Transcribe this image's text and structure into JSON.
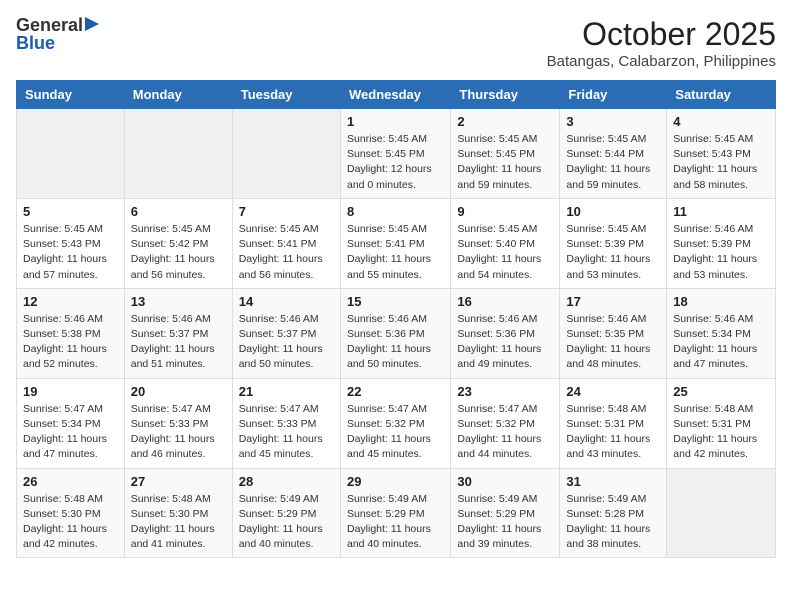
{
  "logo": {
    "general": "General",
    "blue": "Blue"
  },
  "title": "October 2025",
  "location": "Batangas, Calabarzon, Philippines",
  "headers": [
    "Sunday",
    "Monday",
    "Tuesday",
    "Wednesday",
    "Thursday",
    "Friday",
    "Saturday"
  ],
  "weeks": [
    [
      {
        "day": "",
        "info": ""
      },
      {
        "day": "",
        "info": ""
      },
      {
        "day": "",
        "info": ""
      },
      {
        "day": "1",
        "info": "Sunrise: 5:45 AM\nSunset: 5:45 PM\nDaylight: 12 hours\nand 0 minutes."
      },
      {
        "day": "2",
        "info": "Sunrise: 5:45 AM\nSunset: 5:45 PM\nDaylight: 11 hours\nand 59 minutes."
      },
      {
        "day": "3",
        "info": "Sunrise: 5:45 AM\nSunset: 5:44 PM\nDaylight: 11 hours\nand 59 minutes."
      },
      {
        "day": "4",
        "info": "Sunrise: 5:45 AM\nSunset: 5:43 PM\nDaylight: 11 hours\nand 58 minutes."
      }
    ],
    [
      {
        "day": "5",
        "info": "Sunrise: 5:45 AM\nSunset: 5:43 PM\nDaylight: 11 hours\nand 57 minutes."
      },
      {
        "day": "6",
        "info": "Sunrise: 5:45 AM\nSunset: 5:42 PM\nDaylight: 11 hours\nand 56 minutes."
      },
      {
        "day": "7",
        "info": "Sunrise: 5:45 AM\nSunset: 5:41 PM\nDaylight: 11 hours\nand 56 minutes."
      },
      {
        "day": "8",
        "info": "Sunrise: 5:45 AM\nSunset: 5:41 PM\nDaylight: 11 hours\nand 55 minutes."
      },
      {
        "day": "9",
        "info": "Sunrise: 5:45 AM\nSunset: 5:40 PM\nDaylight: 11 hours\nand 54 minutes."
      },
      {
        "day": "10",
        "info": "Sunrise: 5:45 AM\nSunset: 5:39 PM\nDaylight: 11 hours\nand 53 minutes."
      },
      {
        "day": "11",
        "info": "Sunrise: 5:46 AM\nSunset: 5:39 PM\nDaylight: 11 hours\nand 53 minutes."
      }
    ],
    [
      {
        "day": "12",
        "info": "Sunrise: 5:46 AM\nSunset: 5:38 PM\nDaylight: 11 hours\nand 52 minutes."
      },
      {
        "day": "13",
        "info": "Sunrise: 5:46 AM\nSunset: 5:37 PM\nDaylight: 11 hours\nand 51 minutes."
      },
      {
        "day": "14",
        "info": "Sunrise: 5:46 AM\nSunset: 5:37 PM\nDaylight: 11 hours\nand 50 minutes."
      },
      {
        "day": "15",
        "info": "Sunrise: 5:46 AM\nSunset: 5:36 PM\nDaylight: 11 hours\nand 50 minutes."
      },
      {
        "day": "16",
        "info": "Sunrise: 5:46 AM\nSunset: 5:36 PM\nDaylight: 11 hours\nand 49 minutes."
      },
      {
        "day": "17",
        "info": "Sunrise: 5:46 AM\nSunset: 5:35 PM\nDaylight: 11 hours\nand 48 minutes."
      },
      {
        "day": "18",
        "info": "Sunrise: 5:46 AM\nSunset: 5:34 PM\nDaylight: 11 hours\nand 47 minutes."
      }
    ],
    [
      {
        "day": "19",
        "info": "Sunrise: 5:47 AM\nSunset: 5:34 PM\nDaylight: 11 hours\nand 47 minutes."
      },
      {
        "day": "20",
        "info": "Sunrise: 5:47 AM\nSunset: 5:33 PM\nDaylight: 11 hours\nand 46 minutes."
      },
      {
        "day": "21",
        "info": "Sunrise: 5:47 AM\nSunset: 5:33 PM\nDaylight: 11 hours\nand 45 minutes."
      },
      {
        "day": "22",
        "info": "Sunrise: 5:47 AM\nSunset: 5:32 PM\nDaylight: 11 hours\nand 45 minutes."
      },
      {
        "day": "23",
        "info": "Sunrise: 5:47 AM\nSunset: 5:32 PM\nDaylight: 11 hours\nand 44 minutes."
      },
      {
        "day": "24",
        "info": "Sunrise: 5:48 AM\nSunset: 5:31 PM\nDaylight: 11 hours\nand 43 minutes."
      },
      {
        "day": "25",
        "info": "Sunrise: 5:48 AM\nSunset: 5:31 PM\nDaylight: 11 hours\nand 42 minutes."
      }
    ],
    [
      {
        "day": "26",
        "info": "Sunrise: 5:48 AM\nSunset: 5:30 PM\nDaylight: 11 hours\nand 42 minutes."
      },
      {
        "day": "27",
        "info": "Sunrise: 5:48 AM\nSunset: 5:30 PM\nDaylight: 11 hours\nand 41 minutes."
      },
      {
        "day": "28",
        "info": "Sunrise: 5:49 AM\nSunset: 5:29 PM\nDaylight: 11 hours\nand 40 minutes."
      },
      {
        "day": "29",
        "info": "Sunrise: 5:49 AM\nSunset: 5:29 PM\nDaylight: 11 hours\nand 40 minutes."
      },
      {
        "day": "30",
        "info": "Sunrise: 5:49 AM\nSunset: 5:29 PM\nDaylight: 11 hours\nand 39 minutes."
      },
      {
        "day": "31",
        "info": "Sunrise: 5:49 AM\nSunset: 5:28 PM\nDaylight: 11 hours\nand 38 minutes."
      },
      {
        "day": "",
        "info": ""
      }
    ]
  ]
}
